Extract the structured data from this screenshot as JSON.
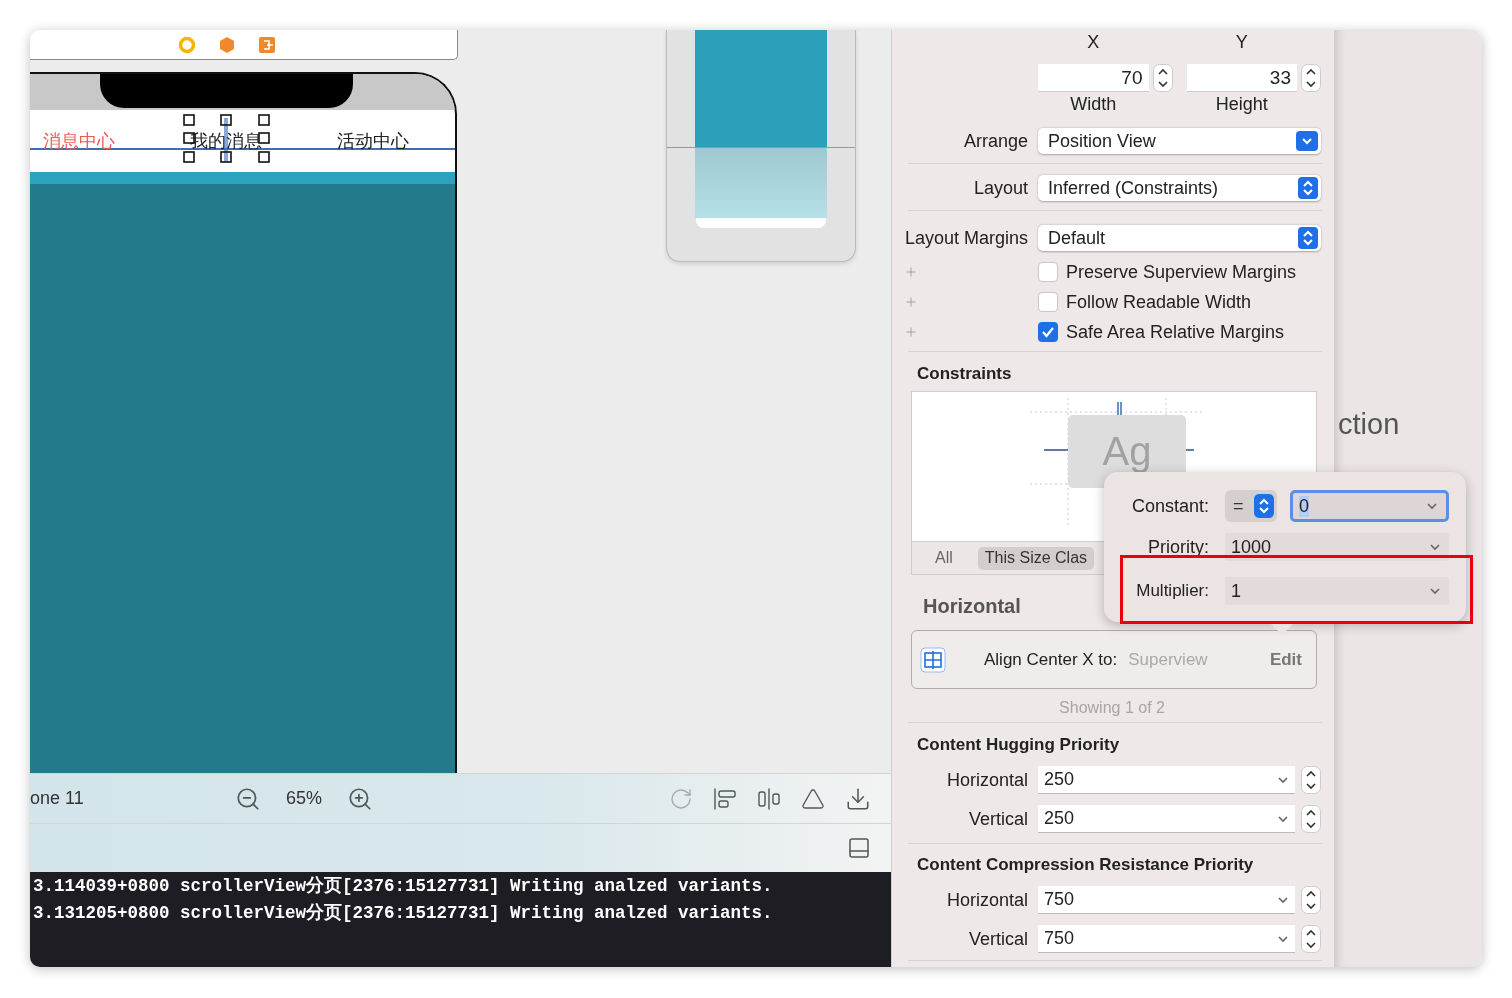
{
  "phone": {
    "tabs": [
      {
        "label": "消息中心",
        "selected": true,
        "handles": false
      },
      {
        "label": "我的消息",
        "selected": false,
        "handles": true
      },
      {
        "label": "活动中心",
        "selected": false,
        "handles": false
      }
    ]
  },
  "canvas_bar": {
    "device": "one 11",
    "zoom": "65%"
  },
  "console": {
    "lines": [
      "3.114039+0800 scrollerView分页[2376:15127731] Writing analzed variants.",
      "3.131205+0800 scrollerView分页[2376:15127731] Writing analzed variants."
    ]
  },
  "inspector": {
    "position": {
      "x_label": "X",
      "y_label": "Y"
    },
    "size": [
      {
        "label": "Width",
        "value": "70"
      },
      {
        "label": "Height",
        "value": "33"
      }
    ],
    "popups": [
      {
        "label": "Arrange",
        "value": "Position View",
        "kind": "pulldown"
      },
      {
        "label": "Layout",
        "value": "Inferred (Constraints)",
        "kind": "popup"
      },
      {
        "label": "Layout Margins",
        "value": "Default",
        "kind": "popup"
      }
    ],
    "margin_options": [
      {
        "label": "Preserve Superview Margins",
        "checked": false
      },
      {
        "label": "Follow Readable Width",
        "checked": false
      },
      {
        "label": "Safe Area Relative Margins",
        "checked": true
      }
    ],
    "constraints": {
      "title": "Constraints",
      "sample": "Ag",
      "filters": [
        {
          "label": "All",
          "selected": false
        },
        {
          "label": "This Size Clas",
          "selected": true
        }
      ],
      "section": "Horizontal",
      "item": {
        "label": "Align Center X to:",
        "target": "Superview",
        "action": "Edit"
      },
      "footer": "Showing 1 of 2"
    },
    "priority_groups": [
      {
        "title": "Content Hugging Priority",
        "rows": [
          {
            "label": "Horizontal",
            "value": "250"
          },
          {
            "label": "Vertical",
            "value": "250"
          }
        ]
      },
      {
        "title": "Content Compression Resistance Priority",
        "rows": [
          {
            "label": "Horizontal",
            "value": "750"
          },
          {
            "label": "Vertical",
            "value": "750"
          }
        ]
      }
    ]
  },
  "background_title": "ction",
  "popover": {
    "constant": {
      "label": "Constant:",
      "relation": "=",
      "value": "0",
      "text_selected": true
    },
    "priority": {
      "label": "Priority:",
      "value": "1000"
    },
    "multiplier": {
      "label": "Multiplier:",
      "value": "1"
    }
  }
}
